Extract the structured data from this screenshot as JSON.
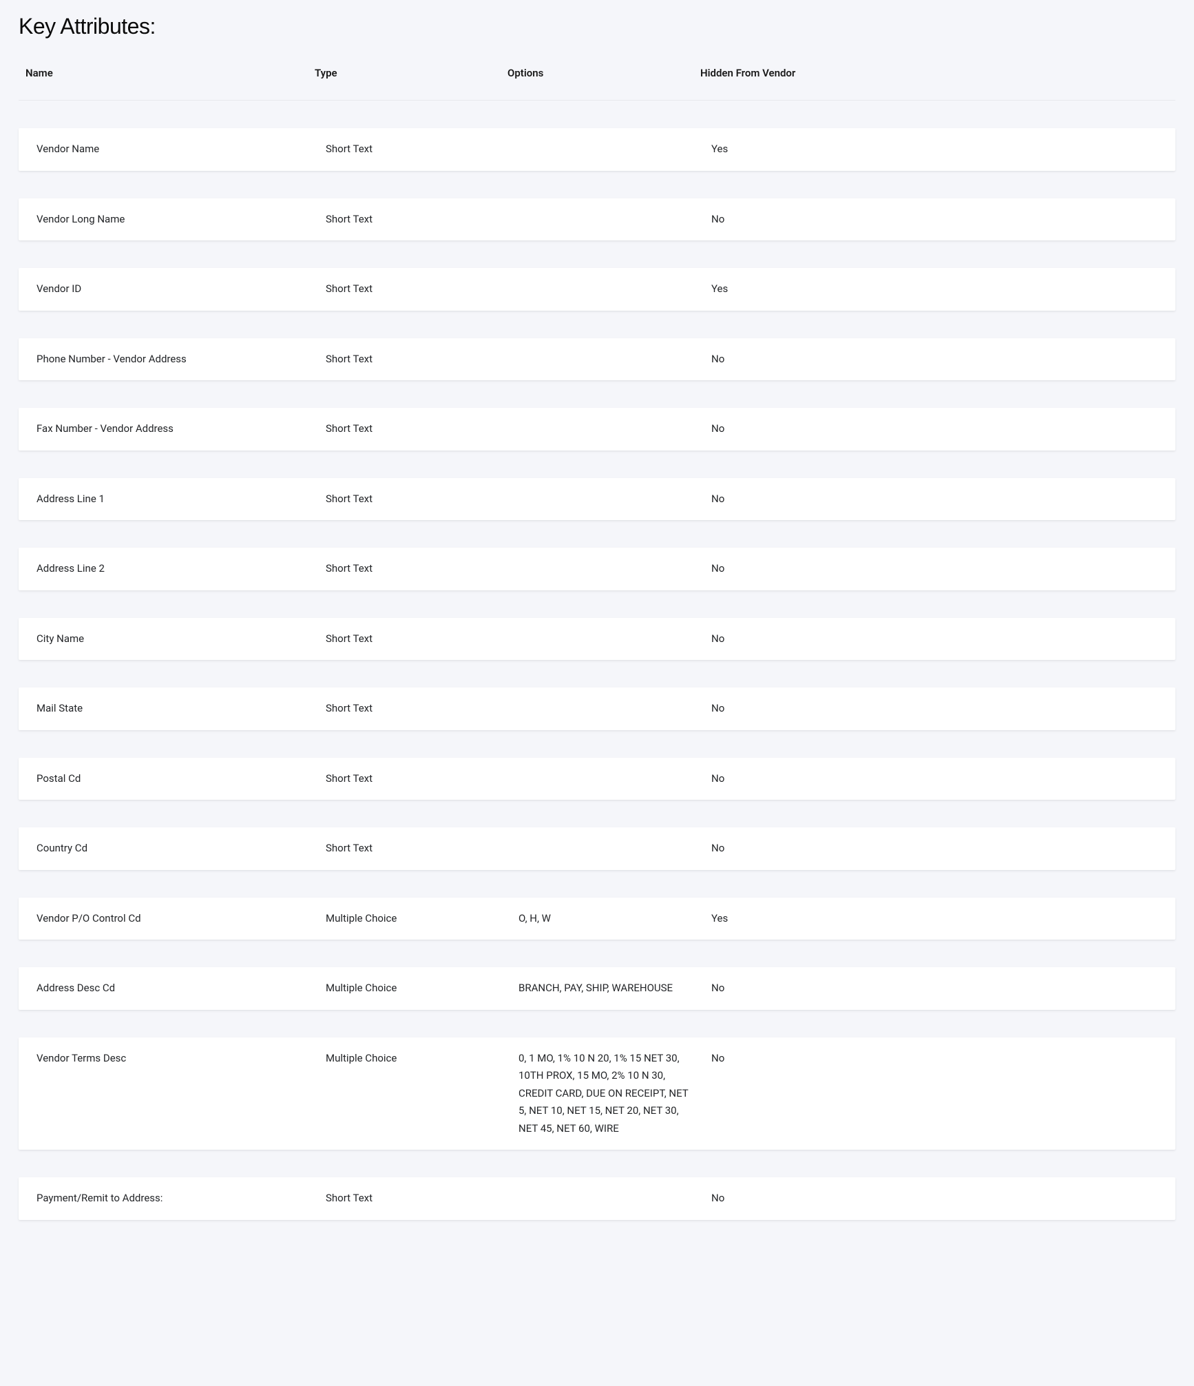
{
  "section_title": "Key Attributes:",
  "headers": {
    "name": "Name",
    "type": "Type",
    "options": "Options",
    "hidden": "Hidden From Vendor"
  },
  "attributes": [
    {
      "name": "Vendor Name",
      "type": "Short Text",
      "options": "",
      "hidden": "Yes"
    },
    {
      "name": "Vendor Long Name",
      "type": "Short Text",
      "options": "",
      "hidden": "No"
    },
    {
      "name": "Vendor ID",
      "type": "Short Text",
      "options": "",
      "hidden": "Yes"
    },
    {
      "name": "Phone Number - Vendor Address",
      "type": "Short Text",
      "options": "",
      "hidden": "No"
    },
    {
      "name": "Fax Number - Vendor Address",
      "type": "Short Text",
      "options": "",
      "hidden": "No"
    },
    {
      "name": "Address Line 1",
      "type": "Short Text",
      "options": "",
      "hidden": "No"
    },
    {
      "name": "Address Line 2",
      "type": "Short Text",
      "options": "",
      "hidden": "No"
    },
    {
      "name": "City Name",
      "type": "Short Text",
      "options": "",
      "hidden": "No"
    },
    {
      "name": "Mail State",
      "type": "Short Text",
      "options": "",
      "hidden": "No"
    },
    {
      "name": "Postal Cd",
      "type": "Short Text",
      "options": "",
      "hidden": "No"
    },
    {
      "name": "Country Cd",
      "type": "Short Text",
      "options": "",
      "hidden": "No"
    },
    {
      "name": "Vendor P/O Control Cd",
      "type": "Multiple Choice",
      "options": "O, H, W",
      "hidden": "Yes"
    },
    {
      "name": "Address Desc Cd",
      "type": "Multiple Choice",
      "options": "BRANCH, PAY, SHIP, WAREHOUSE",
      "hidden": "No"
    },
    {
      "name": "Vendor Terms Desc",
      "type": "Multiple Choice",
      "options": "0, 1 MO, 1% 10 N 20, 1% 15 NET 30, 10TH PROX, 15 MO, 2% 10 N 30, CREDIT CARD, DUE ON RECEIPT, NET 5, NET 10, NET 15, NET 20, NET 30, NET 45, NET 60, WIRE",
      "hidden": "No"
    },
    {
      "name": "Payment/Remit to Address:",
      "type": "Short Text",
      "options": "",
      "hidden": "No"
    }
  ]
}
